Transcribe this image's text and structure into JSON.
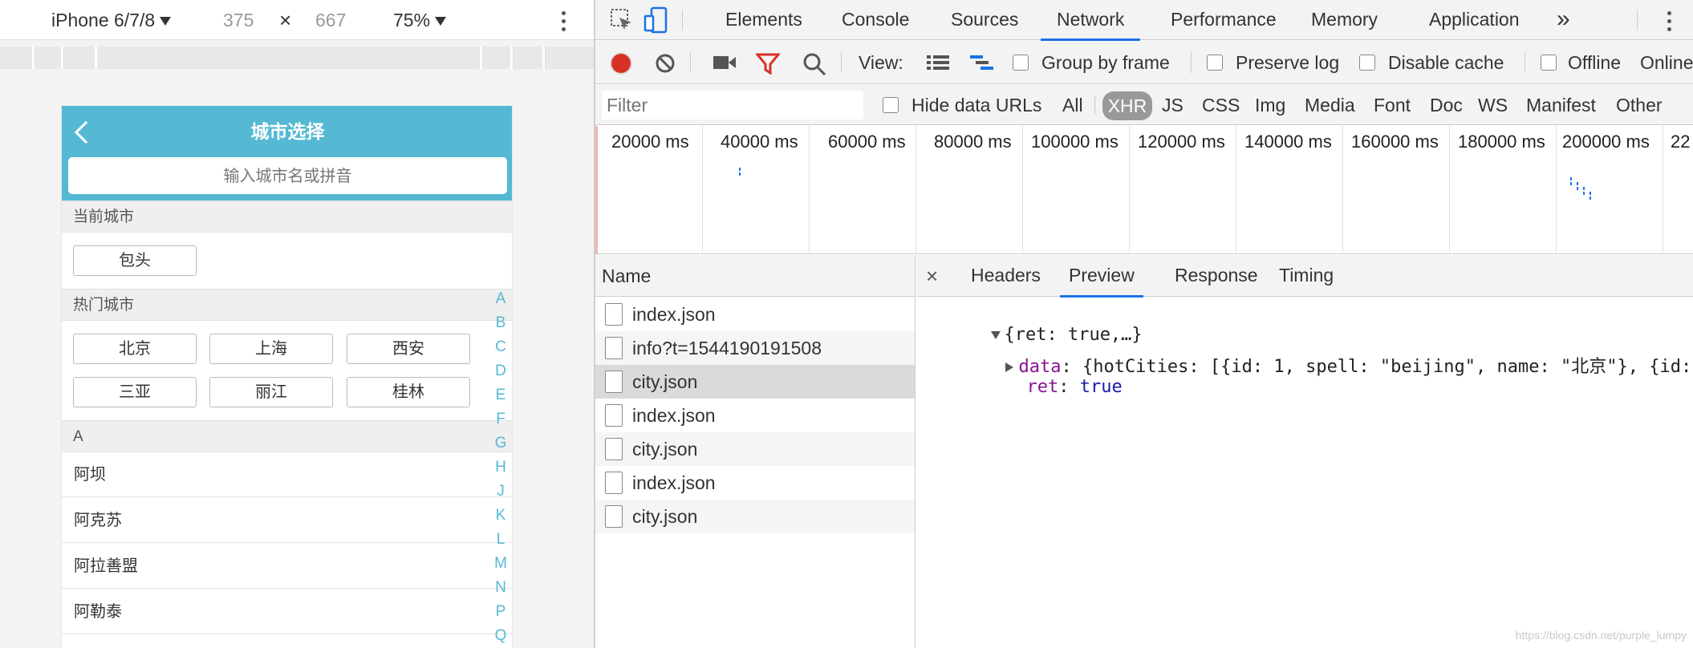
{
  "emulation": {
    "device": "iPhone 6/7/8",
    "width": "375",
    "times": "×",
    "height": "667",
    "zoom": "75%"
  },
  "phone": {
    "title": "城市选择",
    "search_placeholder": "输入城市名或拼音",
    "current_section": "当前城市",
    "current_city": "包头",
    "hot_section": "热门城市",
    "hot_cities": [
      "北京",
      "上海",
      "西安",
      "三亚",
      "丽江",
      "桂林"
    ],
    "letter_section": "A",
    "city_list": [
      "阿坝",
      "阿克苏",
      "阿拉善盟",
      "阿勒泰"
    ],
    "alphabet": [
      "A",
      "B",
      "C",
      "D",
      "E",
      "F",
      "G",
      "H",
      "J",
      "K",
      "L",
      "M",
      "N",
      "P",
      "Q"
    ]
  },
  "devtools": {
    "tabs": [
      "Elements",
      "Console",
      "Sources",
      "Network",
      "Performance",
      "Memory",
      "Application"
    ],
    "more": "»",
    "toolbar": {
      "view": "View:",
      "group_by_frame": "Group by frame",
      "preserve_log": "Preserve log",
      "disable_cache": "Disable cache",
      "offline": "Offline",
      "online": "Online"
    },
    "filter": {
      "placeholder": "Filter",
      "hide_data_urls": "Hide data URLs",
      "types": [
        "All",
        "XHR",
        "JS",
        "CSS",
        "Img",
        "Media",
        "Font",
        "Doc",
        "WS",
        "Manifest",
        "Other"
      ]
    },
    "timeline_ticks": [
      "20000 ms",
      "40000 ms",
      "60000 ms",
      "80000 ms",
      "100000 ms",
      "120000 ms",
      "140000 ms",
      "160000 ms",
      "180000 ms",
      "200000 ms",
      "22"
    ],
    "requests_header": "Name",
    "requests": [
      "index.json",
      "info?t=1544190191508",
      "city.json",
      "index.json",
      "city.json",
      "index.json",
      "city.json"
    ],
    "detail_tabs": [
      "Headers",
      "Preview",
      "Response",
      "Timing"
    ],
    "close": "×",
    "preview": {
      "line1": "{ret: true,…}",
      "data_key": "data",
      "data_val": ": {hotCities: [{id: 1, spell: \"beijing\", name: \"北京\"}, {id:",
      "ret_key": "ret",
      "ret_val": "true"
    }
  },
  "watermark": "https://blog.csdn.net/purple_lumpy"
}
